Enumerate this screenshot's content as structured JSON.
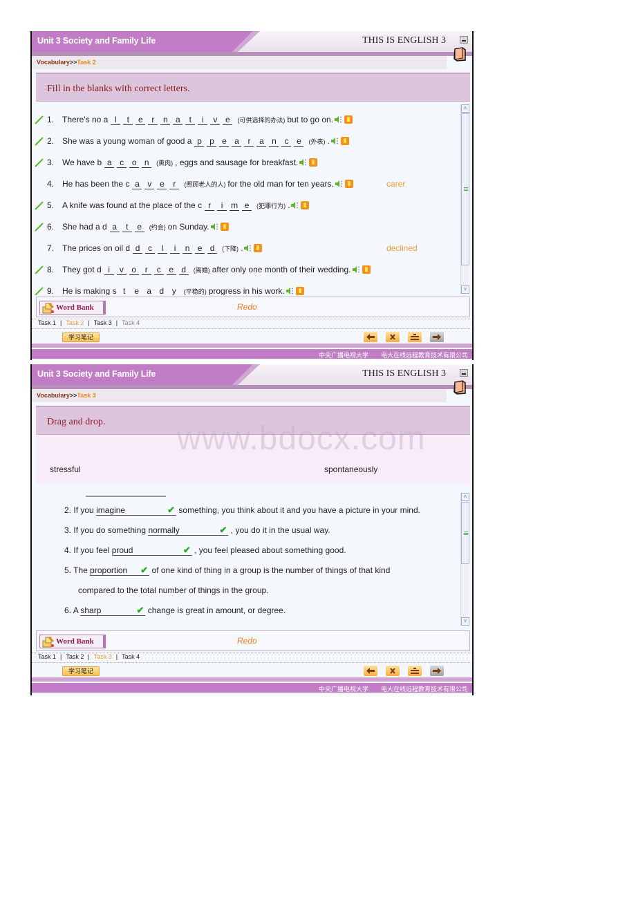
{
  "frames": [
    {
      "unit_title": "Unit 3 Society and Family Life",
      "brand": "THIS IS ENGLISH 3",
      "breadcrumb": {
        "section": "Vocabulary",
        "separator": ">>",
        "current": "Task 2"
      },
      "instruction": "Fill in the blanks with correct letters.",
      "questions": [
        {
          "num": "1.",
          "checked": true,
          "before": "There's no a",
          "letters": [
            "l",
            "t",
            "e",
            "r",
            "n",
            "a",
            "t",
            "i",
            "v",
            "e"
          ],
          "cn": "(可供选择的办法)",
          "after": "but to go on.",
          "answer": ""
        },
        {
          "num": "2.",
          "checked": true,
          "before": "She was a young woman of good a",
          "letters": [
            "p",
            "p",
            "e",
            "a",
            "r",
            "a",
            "n",
            "c",
            "e"
          ],
          "cn": "(外表)",
          "after": ".",
          "answer": ""
        },
        {
          "num": "3.",
          "checked": true,
          "before": "We have b",
          "letters": [
            "a",
            "c",
            "o",
            "n"
          ],
          "cn": "(熏肉)",
          "after": ", eggs and sausage for breakfast.",
          "answer": ""
        },
        {
          "num": "4.",
          "checked": false,
          "before": "He has been the c",
          "letters": [
            "a",
            "v",
            "e",
            "r"
          ],
          "cn": "(照顾老人的人)",
          "after": "for the old man for ten years.",
          "answer": "carer"
        },
        {
          "num": "5.",
          "checked": true,
          "before": "A knife was found at the place of the c",
          "letters": [
            "r",
            "i",
            "m",
            "e"
          ],
          "cn": "(犯罪行为)",
          "after": ".",
          "answer": ""
        },
        {
          "num": "6.",
          "checked": true,
          "before": "She had a d",
          "letters": [
            "a",
            "t",
            "e"
          ],
          "cn": "(约会)",
          "after": "on Sunday.",
          "answer": ""
        },
        {
          "num": "7.",
          "checked": false,
          "before": "The prices on oil d",
          "letters": [
            "d",
            "c",
            "l",
            "i",
            "n",
            "e",
            "d"
          ],
          "cn": "(下降)",
          "after": ".",
          "answer": "declined"
        },
        {
          "num": "8.",
          "checked": true,
          "before": "They got d",
          "letters": [
            "i",
            "v",
            "o",
            "r",
            "c",
            "e",
            "d"
          ],
          "cn": "(离婚)",
          "after": "after only one month of their wedding.",
          "answer": ""
        },
        {
          "num": "9.",
          "checked": true,
          "before": "He is making s",
          "letters": [
            "t",
            "e",
            "a",
            "d",
            "y"
          ],
          "cn": "(平稳的)",
          "after": "progress in his work.",
          "answer": ""
        }
      ],
      "word_bank_label": "Word Bank",
      "redo_label": "Redo",
      "tasks": [
        "Task 1",
        "Task 2",
        "Task 3",
        "Task 4"
      ],
      "active_task": 1,
      "notes_label": "学习笔记",
      "footer": [
        "中央广播电视大学",
        "电大在线远程教育技术有限公司"
      ]
    },
    {
      "unit_title": "Unit 3 Society and Family Life",
      "brand": "THIS IS ENGLISH 3",
      "breadcrumb": {
        "section": "Vocabulary",
        "separator": ">>",
        "current": "Task 3"
      },
      "instruction": "Drag and drop.",
      "watermark": "www.bdocx.com",
      "word_pool": [
        "stressful",
        "spontaneously"
      ],
      "items": [
        {
          "num": "2.",
          "before": "If you",
          "answer": "imagine",
          "after": "something, you think about it and you have a picture in your mind."
        },
        {
          "num": "3.",
          "before": "If you do something",
          "answer": "normally",
          "after": ", you do it in the usual way."
        },
        {
          "num": "4.",
          "before": "If you feel",
          "answer": "proud",
          "after": ", you feel pleased about something good."
        },
        {
          "num": "5.",
          "before": "The",
          "answer": "proportion",
          "after": "of one kind of thing in a group is the number of things of that kind",
          "cont": "compared to the total number of things in the group."
        },
        {
          "num": "6.",
          "before": "A",
          "answer": "sharp",
          "after": "change is great in amount, or degree."
        }
      ],
      "check_mark": "✔",
      "word_bank_label": "Word Bank",
      "redo_label": "Redo",
      "tasks": [
        "Task 1",
        "Task 2",
        "Task 3",
        "Task 4"
      ],
      "active_task": 2,
      "notes_label": "学习笔记",
      "footer": [
        "中央广播电视大学",
        "电大在线远程教育技术有限公司"
      ]
    }
  ]
}
